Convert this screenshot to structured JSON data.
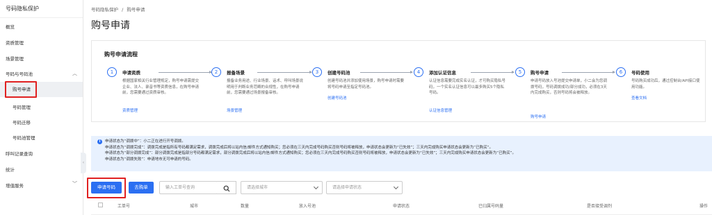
{
  "sidebar": {
    "title": "号码隐私保护",
    "items": [
      {
        "label": "概览"
      },
      {
        "label": "资质管理"
      },
      {
        "label": "场景管理"
      },
      {
        "label": "号码与号码池"
      },
      {
        "label": "购号申请"
      },
      {
        "label": "号码管理"
      },
      {
        "label": "号码迁移"
      },
      {
        "label": "号码池管理"
      },
      {
        "label": "呼叫记录查询"
      },
      {
        "label": "统计"
      },
      {
        "label": "增值服务"
      }
    ]
  },
  "breadcrumb": {
    "root": "号码隐私保护",
    "sep": "/",
    "current": "购号申请"
  },
  "page_title": "购号申请",
  "flow": {
    "title": "购号申请流程",
    "steps": [
      {
        "num": "1",
        "title": "申请资质",
        "desc": "根据国家相关行业管理规定，购号申请需提交企业、法人、录音书等资质信息，在购号申请前，您需要通过资质审核。",
        "link": "资质管理"
      },
      {
        "num": "2",
        "title": "报备场景",
        "desc": "报备业务用途、行业场景、话术、呼叫场景说明用于判断业务范畴的合规性，在购号申请前，您需要通过场景报备审核。",
        "link": "场景管理"
      },
      {
        "num": "3",
        "title": "创建号码池",
        "desc": "创建号码池并添加使用场景，购号申请时需要将号码申请至指定号码池。",
        "link": "创建号码池"
      },
      {
        "num": "4",
        "title": "添加认证信息",
        "desc": "认证信息需要完成实名认证，才可购买隐私号码，一个实名认证信息可以最多购买5个隐私号码。",
        "link": "认证信息管理"
      },
      {
        "num": "5",
        "title": "购号申请",
        "desc": "申请号码放入号池提交申请单，小二会为您调拨号码，号码调拨成功/部分成功，必须在3天内完成购买，否则号码将会被释放。",
        "link": "购号申请"
      },
      {
        "num": "6",
        "title": "号码使用",
        "desc": "号码购买成功后，通过控制台/API接口使用功能。",
        "link": "查看文档"
      }
    ]
  },
  "notice": {
    "icon": "info-icon",
    "lines": [
      "申请状态为“调拨中”：小二正在进行开号调拨。",
      "申请状态为“调拨完成”：调拨完成是指所有号码都满足需求，调拨完成后将以站内信/邮件方式通知购买；您必须在三天内完成号码购买否则号码将被释放，申请状态会更新为“已失效”；三天内完成购买申请状态会更新为“已购买”。",
      "申请状态为“部分调拨完成”：部分调拨完成是指部分号码都满足需求，部分调拨完成后将以站内信/邮件方式通知购买；您必须在三天内完成号码购买否则号码将被释放，申请状态会更新为“已失效”；三天内完成购买申请状态会更新为“已购买”。",
      "申请状态为“调拨失败”：申请地市无可申请的号码。"
    ]
  },
  "toolbar": {
    "apply_label": "申请号码",
    "buy_label": "去购单",
    "order_placeholder": "输入工单号查询",
    "city_placeholder": "请选择城市",
    "status_placeholder": "请选择申请状态"
  },
  "table": {
    "columns": [
      "工单号",
      "城市",
      "数量",
      "放入号池",
      "申请状态",
      "已归属号码量",
      "是否接受调剂",
      "操作"
    ]
  },
  "colors": {
    "accent": "#2b6ff2",
    "highlight": "#e02020",
    "notice_bg": "#e8f1fe"
  }
}
